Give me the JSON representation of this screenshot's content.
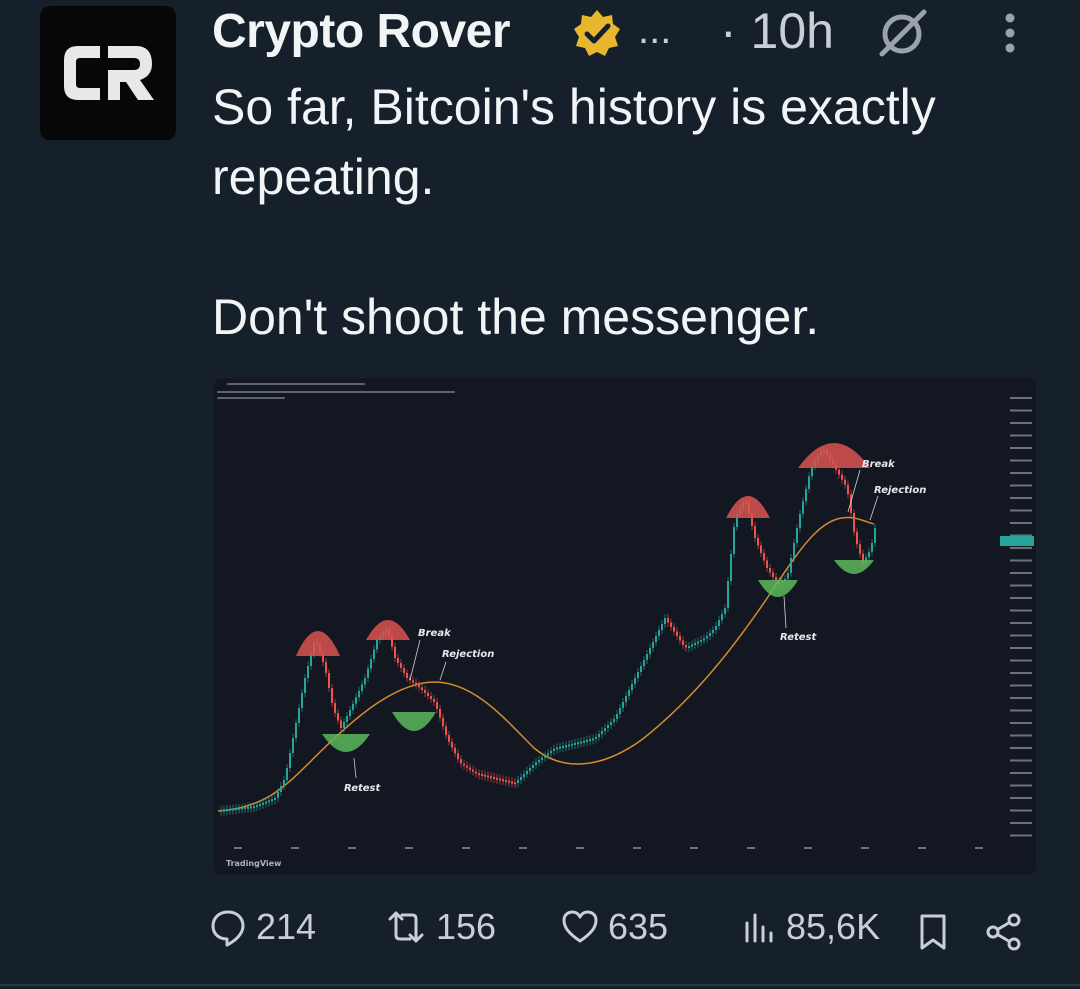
{
  "post": {
    "author_name": "Crypto Rover",
    "avatar_text": "CR",
    "ellipsis": "...",
    "time": "· 10h",
    "text_line1": "So far, Bitcoin's history is exactly",
    "text_line2": "repeating.",
    "text_line3": "Don't shoot the messenger."
  },
  "chart_image": {
    "annotations": {
      "break_1": "Break",
      "rejection_1": "Rejection",
      "retest_1": "Retest",
      "break_2": "Break",
      "rejection_2": "Rejection",
      "retest_2": "Retest"
    },
    "watermark": "TradingView"
  },
  "actions": {
    "replies": "214",
    "reposts": "156",
    "likes": "635",
    "views": "85,6K"
  },
  "icons": {
    "verified": "verified-badge-icon",
    "grok": "grok-icon",
    "more": "more-vertical-icon",
    "reply": "reply-icon",
    "repost": "repost-icon",
    "like": "heart-icon",
    "views": "views-icon",
    "bookmark": "bookmark-icon",
    "share": "share-icon"
  },
  "colors": {
    "background": "#15202b",
    "text": "#f2f4f6",
    "muted": "#c9cfd4",
    "verified_gold": "#e8b72e",
    "chart_up": "#26a69a",
    "chart_down": "#ef5350",
    "chart_ma": "#d68a2e"
  }
}
